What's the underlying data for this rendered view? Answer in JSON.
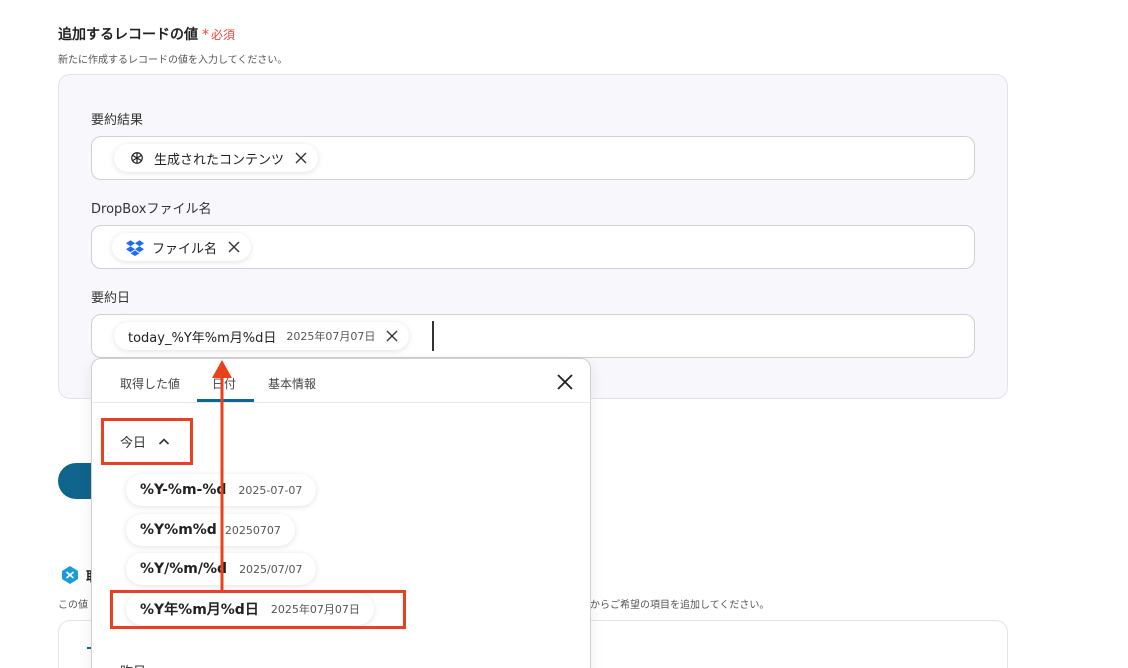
{
  "section": {
    "title": "追加するレコードの値",
    "required_star": "*",
    "required_text": "必須",
    "description": "新たに作成するレコードの値を入力してください。"
  },
  "fields": [
    {
      "label": "要約結果",
      "chip_label": "生成されたコンテンツ",
      "chip_icon": "openai-icon"
    },
    {
      "label": "DropBoxファイル名",
      "chip_label": "ファイル名",
      "chip_icon": "dropbox-icon"
    },
    {
      "label": "要約日",
      "chip_label": "today_%Y年%m月%d日",
      "chip_value": "2025年07月07日"
    }
  ],
  "dropdown": {
    "tabs": [
      "取得した値",
      "日付",
      "基本情報"
    ],
    "active_tab": 1,
    "group_today": "今日",
    "options": [
      {
        "format": "%Y-%m-%d",
        "value": "2025-07-07"
      },
      {
        "format": "%Y%m%d",
        "value": "20250707"
      },
      {
        "format": "%Y/%m/%d",
        "value": "2025/07/07"
      },
      {
        "format": "%Y年%m月%d日",
        "value": "2025年07月07日"
      }
    ],
    "group_yesterday": "昨日"
  },
  "lower_section": {
    "title_char": "取",
    "description_start": "この値",
    "description_end": "からご希望の項目を追加してください。"
  },
  "colors": {
    "accent": "#10658c",
    "required": "#e8473d",
    "annotation": "#e8421d",
    "dropbox": "#1f6bf5"
  }
}
